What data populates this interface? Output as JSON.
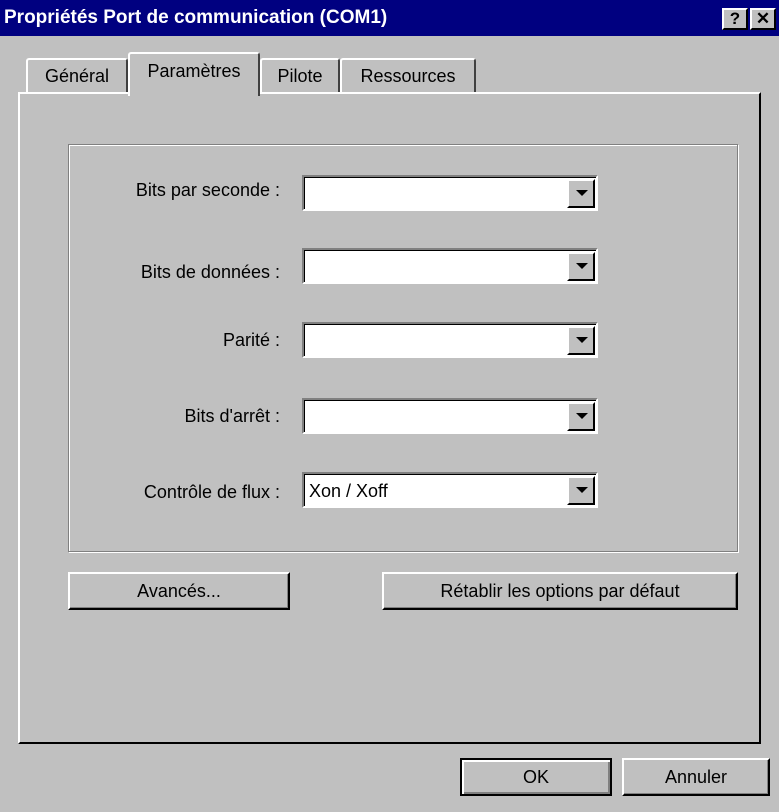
{
  "window": {
    "title": "Propriétés Port de communication (COM1)",
    "help_glyph": "?",
    "close_glyph": "✕"
  },
  "tabs": [
    {
      "label": "Général"
    },
    {
      "label": "Paramètres",
      "selected": true
    },
    {
      "label": "Pilote"
    },
    {
      "label": "Ressources"
    }
  ],
  "settings": {
    "bits_per_second": {
      "label": "Bits par seconde :",
      "value": ""
    },
    "data_bits": {
      "label": "Bits de données :",
      "value": ""
    },
    "parity": {
      "label": "Parité :",
      "value": ""
    },
    "stop_bits": {
      "label": "Bits d'arrêt :",
      "value": ""
    },
    "flow_control": {
      "label": "Contrôle de flux :",
      "value": "Xon / Xoff"
    }
  },
  "buttons": {
    "advanced": "Avancés...",
    "restore_defaults": "Rétablir les options par défaut",
    "ok": "OK",
    "cancel": "Annuler"
  },
  "colors": {
    "titlebar": "#000080",
    "face": "#c0c0c0"
  }
}
